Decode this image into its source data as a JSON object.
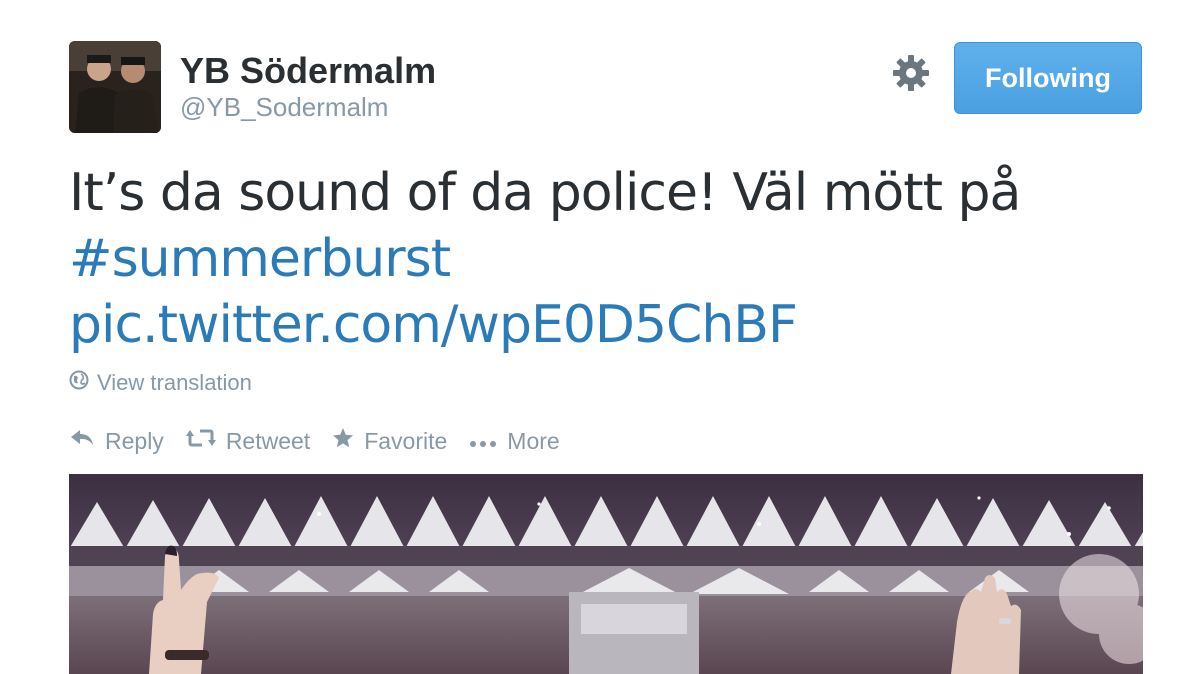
{
  "user": {
    "name": "YB Södermalm",
    "handle": "@YB_Sodermalm"
  },
  "icons": {
    "gear": "gear-icon",
    "globe": "globe-icon",
    "reply": "reply-icon",
    "retweet": "retweet-icon",
    "favorite": "star-icon",
    "more": "ellipsis-icon"
  },
  "follow_button": {
    "label": "Following"
  },
  "tweet": {
    "text_line1": "It’s da sound of da police! Väl mött på",
    "hashtag": "#summerburst",
    "link": "pic.twitter.com/wpE0D5ChBF"
  },
  "translation": {
    "label": "View translation"
  },
  "actions": {
    "reply": "Reply",
    "retweet": "Retweet",
    "favorite": "Favorite",
    "more": "More"
  },
  "colors": {
    "text": "#292f33",
    "muted": "#8899a6",
    "link": "#2b7bb9",
    "button": "#55acee"
  }
}
